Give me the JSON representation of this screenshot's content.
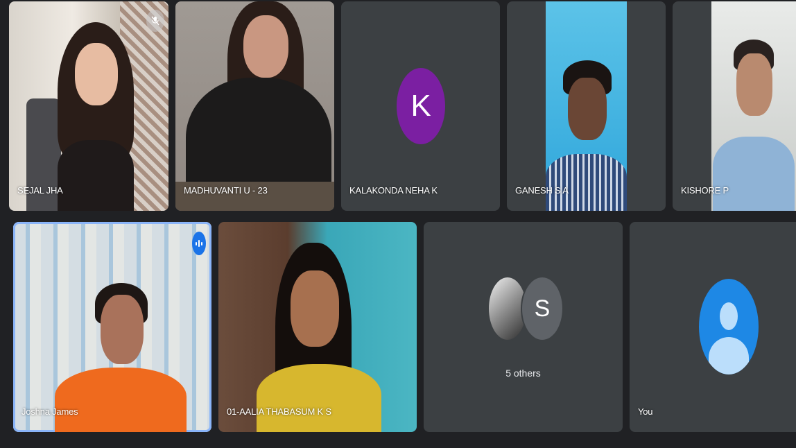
{
  "participants": [
    {
      "name": "SEJAL JHA",
      "muted": true
    },
    {
      "name": "MADHUVANTI U - 23"
    },
    {
      "name": "KALAKONDA NEHA K",
      "initial": "K",
      "avatar_color": "#7b1fa2"
    },
    {
      "name": "GANESH S A"
    },
    {
      "name": "KISHORE P"
    },
    {
      "name": "Joshna James",
      "speaking": true
    },
    {
      "name": "01-AALIA THABASUM K S"
    }
  ],
  "others": {
    "label": "5 others",
    "initial": "S",
    "avatar_color": "#5f6368"
  },
  "self": {
    "name": "You",
    "avatar_color": "#1e88e5"
  },
  "colors": {
    "background": "#202124",
    "tile": "#3c4043",
    "active_outline": "#8ab4f8",
    "speaking_badge": "#1a73e8"
  },
  "icons": [
    "mic-off-icon",
    "audio-level-icon",
    "default-avatar-icon"
  ]
}
